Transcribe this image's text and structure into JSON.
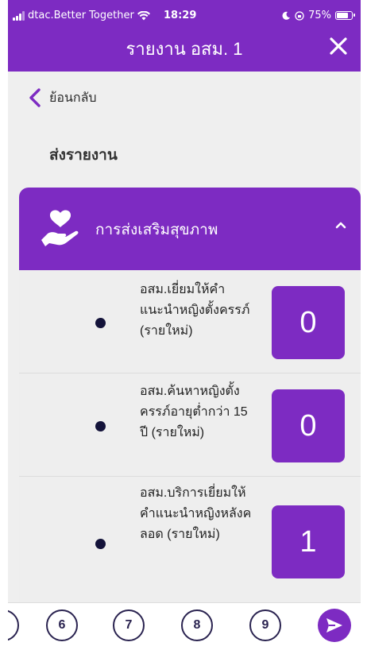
{
  "status_bar": {
    "carrier": "dtac.Better Together",
    "time": "18:29",
    "battery": "75%"
  },
  "header": {
    "title": "รายงาน อสม. 1"
  },
  "back": {
    "label": "ย้อนกลับ"
  },
  "section_title": "ส่งรายงาน",
  "card": {
    "title": "การส่งเสริมสุขภาพ",
    "items": [
      {
        "label": "อสม.เยี่ยมให้คำแนะนำหญิงตั้งครรภ์ (รายใหม่)",
        "value": "0"
      },
      {
        "label": "อสม.ค้นหาหญิงตั้งครรภ์อายุต่ำกว่า 15 ปี (รายใหม่)",
        "value": "0"
      },
      {
        "label": "อสม.บริการเยี่ยมให้คำแนะนำหญิงหลังคลอด (รายใหม่)",
        "value": "1"
      }
    ]
  },
  "pager": {
    "pages": [
      "6",
      "7",
      "8",
      "9"
    ]
  },
  "colors": {
    "primary": "#7d2bc2",
    "dark": "#2a2350",
    "background": "#efefef"
  }
}
